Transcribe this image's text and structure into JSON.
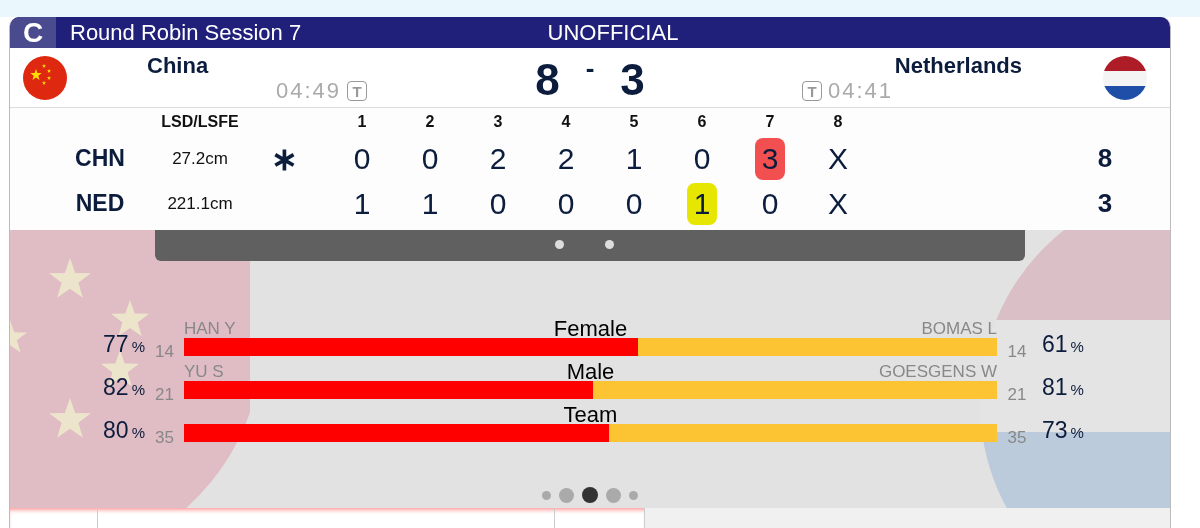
{
  "header": {
    "badge": "C",
    "title": "Round Robin Session 7",
    "status": "UNOFFICIAL"
  },
  "teams": [
    {
      "kind": "china",
      "name": "China",
      "time": "04:49",
      "timeout_mark": "T",
      "score": "8"
    },
    {
      "kind": "netherlands",
      "name": "Netherlands",
      "time": "04:41",
      "timeout_mark": "T",
      "score": "3"
    }
  ],
  "score_separator": "-",
  "linescore": {
    "lsd_heading": "LSD/LSFE",
    "end_headings": [
      "1",
      "2",
      "3",
      "4",
      "5",
      "6",
      "7",
      "8"
    ],
    "rows": [
      {
        "team": "CHN",
        "lsd": "27.2cm",
        "hammer": "∗",
        "ends": [
          {
            "value": "0"
          },
          {
            "value": "0"
          },
          {
            "value": "2"
          },
          {
            "value": "2"
          },
          {
            "value": "1"
          },
          {
            "value": "0"
          },
          {
            "value": "3",
            "color": "#f25050"
          },
          {
            "value": "X"
          }
        ],
        "total": "8"
      },
      {
        "team": "NED",
        "lsd": "221.1cm",
        "ends": [
          {
            "value": "1"
          },
          {
            "value": "1"
          },
          {
            "value": "0"
          },
          {
            "value": "0"
          },
          {
            "value": "0"
          },
          {
            "value": "1",
            "color": "#e6e600"
          },
          {
            "value": "0"
          },
          {
            "value": "X"
          }
        ],
        "total": "3"
      }
    ]
  },
  "stats": [
    {
      "title": "Female",
      "left_player": "HAN Y",
      "left_count": "14",
      "left_pct": "77",
      "left_unit": "%",
      "right_player": "BOMAS L",
      "right_count": "14",
      "right_pct": "61",
      "right_unit": "%",
      "level": 0.558
    },
    {
      "title": "Male",
      "left_player": "YU S",
      "left_count": "21",
      "left_pct": "82",
      "left_unit": "%",
      "right_player": "GOESGENS W",
      "right_count": "21",
      "right_pct": "81",
      "right_unit": "%",
      "level": 0.503
    },
    {
      "title": "Team",
      "left_count": "35",
      "left_pct": "80",
      "left_unit": "%",
      "right_count": "35",
      "right_pct": "73",
      "right_unit": "%",
      "level": 0.523
    }
  ],
  "pager": [
    {
      "selected": false
    },
    {
      "selected": false
    },
    {
      "selected": true
    },
    {
      "selected": false
    },
    {
      "selected": false
    }
  ]
}
